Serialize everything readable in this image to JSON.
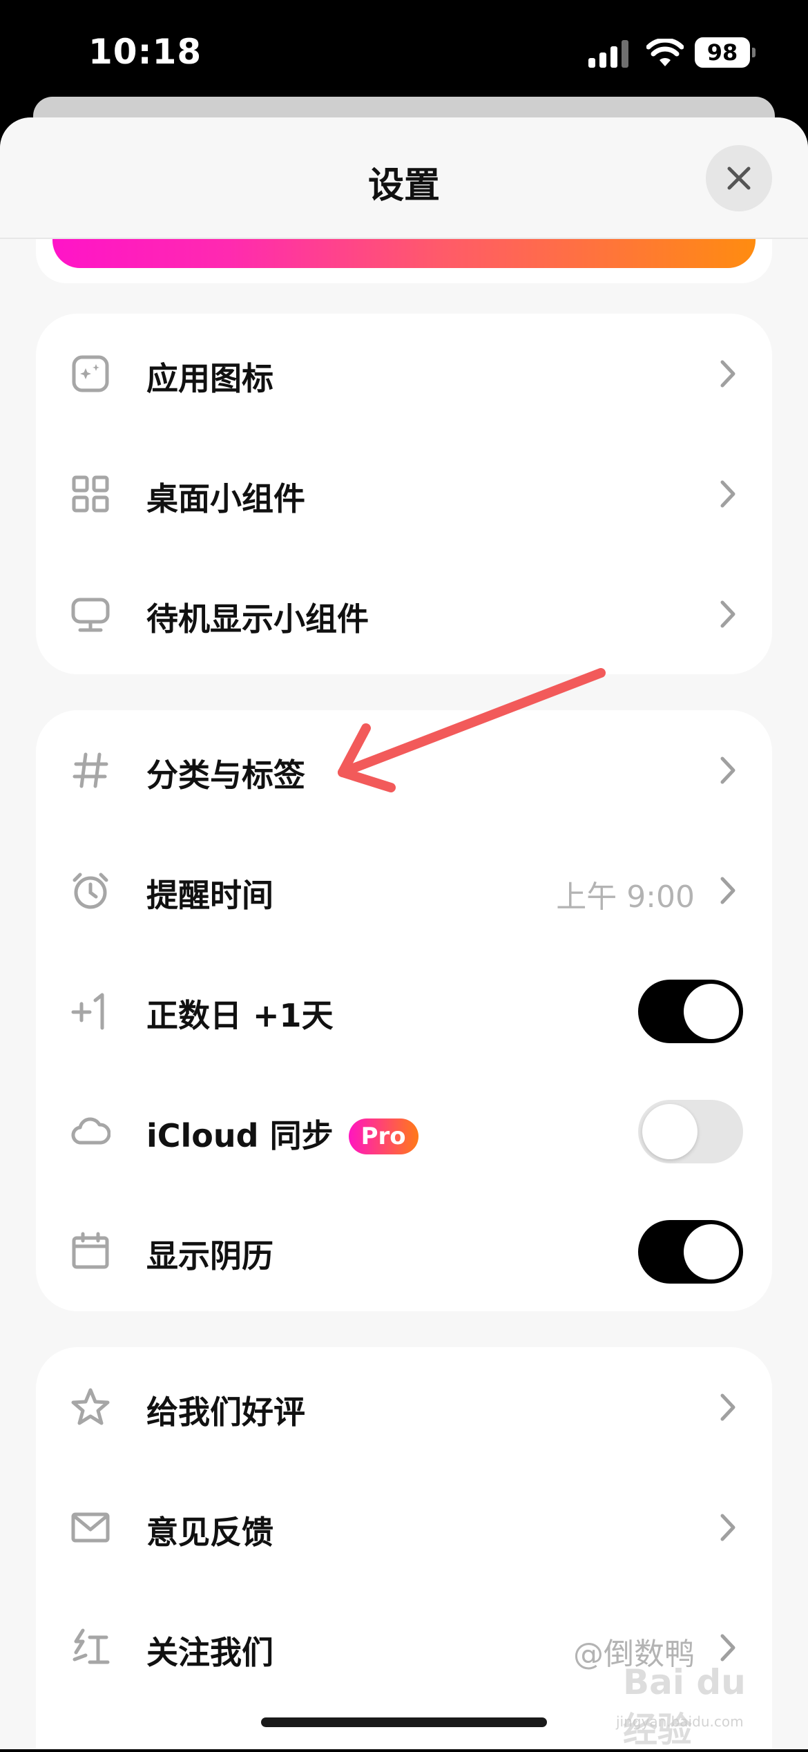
{
  "status_bar": {
    "time": "10:18",
    "battery": "98"
  },
  "header": {
    "title": "设置"
  },
  "groups": [
    {
      "items": [
        {
          "label": "应用图标",
          "icon": "app-icon"
        },
        {
          "label": "桌面小组件",
          "icon": "widgets-icon"
        },
        {
          "label": "待机显示小组件",
          "icon": "standby-display-icon"
        }
      ]
    },
    {
      "items": [
        {
          "label": "分类与标签",
          "icon": "hashtag-icon"
        },
        {
          "label": "提醒时间",
          "icon": "alarm-clock-icon",
          "value": "上午 9:00"
        },
        {
          "label": "正数日 +1天",
          "icon": "plus-one-icon",
          "toggle": true
        },
        {
          "label": "iCloud 同步",
          "icon": "cloud-icon",
          "badge": "Pro",
          "toggle": false
        },
        {
          "label": "显示阴历",
          "icon": "calendar-icon",
          "toggle": true
        }
      ]
    },
    {
      "items": [
        {
          "label": "给我们好评",
          "icon": "star-icon"
        },
        {
          "label": "意见反馈",
          "icon": "mail-icon"
        },
        {
          "label": "关注我们",
          "icon": "rednote-icon",
          "value": "@倒数鸭"
        }
      ]
    }
  ],
  "watermark": {
    "logo": "Bai du 经验",
    "url": "jingyan.baidu.com"
  },
  "colors": {
    "accent_gradient_start": "#ff14c8",
    "accent_gradient_end": "#ff8c10",
    "annotation_arrow": "#f25a5a",
    "toggle_on": "#000000",
    "toggle_off": "#e5e5e5"
  }
}
